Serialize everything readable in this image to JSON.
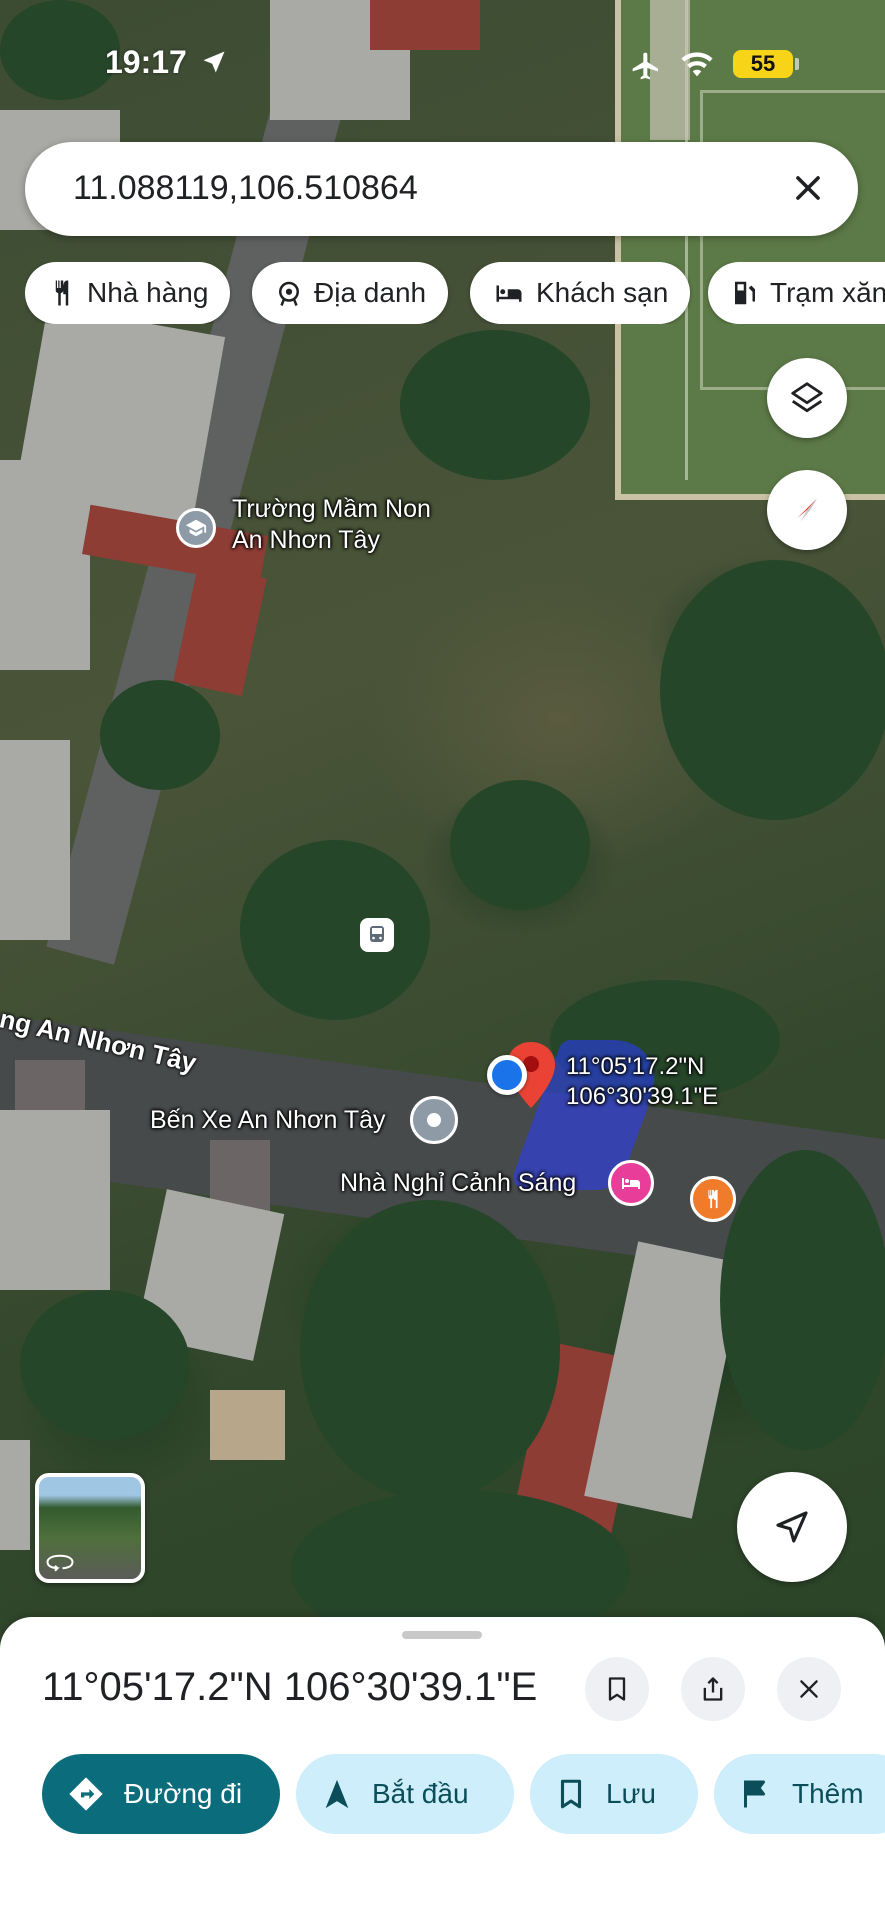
{
  "status_bar": {
    "time": "19:17",
    "battery": "55"
  },
  "search": {
    "value": "11.088119,106.510864"
  },
  "chips": [
    {
      "label": "Nhà hàng",
      "icon": "restaurant-icon"
    },
    {
      "label": "Địa danh",
      "icon": "landmark-icon"
    },
    {
      "label": "Khách sạn",
      "icon": "hotel-icon"
    },
    {
      "label": "Trạm xăng",
      "icon": "gas-station-icon"
    }
  ],
  "map": {
    "school": {
      "line1": "Trường Mầm Non",
      "line2": "An Nhơn Tây"
    },
    "road_name": "ng An Nhơn Tây",
    "bus_station": "Bến Xe An Nhơn Tây",
    "motel": "Nhà Nghỉ Cảnh Sáng",
    "pin_coords": {
      "line1": "11°05'17.2\"N",
      "line2": "106°30'39.1\"E"
    }
  },
  "sheet": {
    "title": "11°05'17.2\"N 106°30'39.1\"E",
    "actions": [
      {
        "label": "Đường đi"
      },
      {
        "label": "Bắt đầu"
      },
      {
        "label": "Lưu"
      },
      {
        "label": "Thêm"
      }
    ]
  },
  "colors": {
    "primary": "#0b6d7b",
    "secondary": "#cdeefa",
    "pin_red": "#ea4335",
    "user_dot": "#1a73e8",
    "battery": "#f7d417"
  }
}
